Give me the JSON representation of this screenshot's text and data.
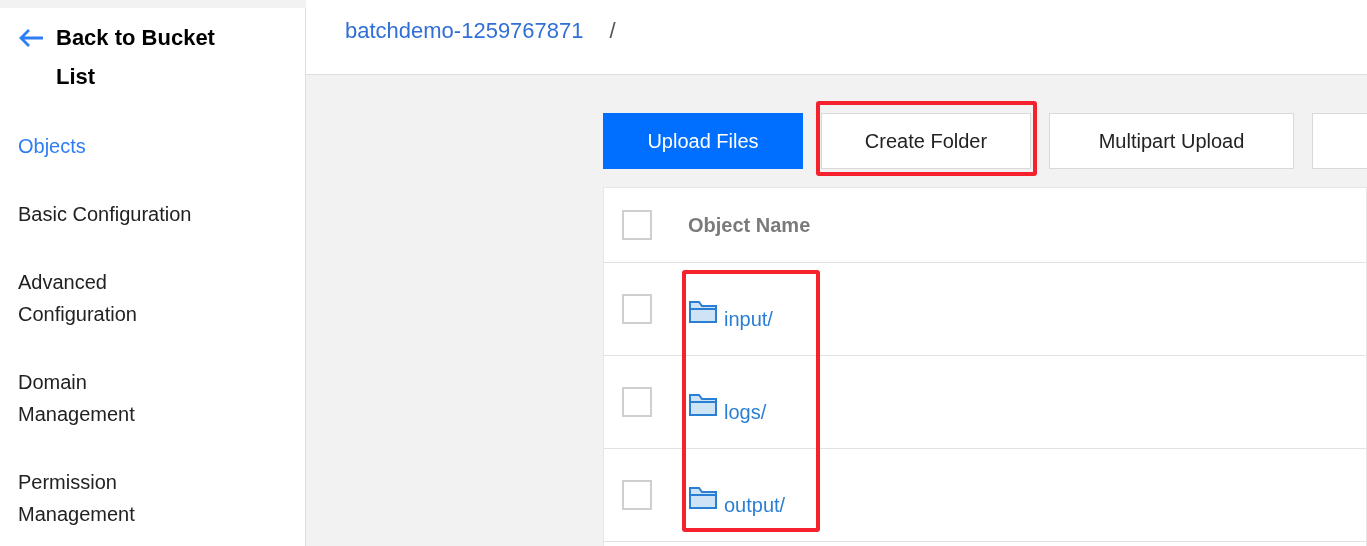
{
  "sidebar": {
    "back_link": "Back to Bucket List",
    "items": [
      {
        "label": "Objects",
        "selected": true
      },
      {
        "label": "Basic Configuration",
        "selected": false
      },
      {
        "label": "Advanced Configuration",
        "selected": false
      },
      {
        "label": "Domain Management",
        "selected": false
      },
      {
        "label": "Permission Management",
        "selected": false
      }
    ]
  },
  "breadcrumb": {
    "bucket": "batchdemo-1259767871",
    "separator": "/"
  },
  "toolbar": {
    "buttons": [
      {
        "label": "Upload Files",
        "kind": "primary",
        "highlighted": false
      },
      {
        "label": "Create Folder",
        "kind": "default",
        "highlighted": true
      },
      {
        "label": "Multipart Upload",
        "kind": "default",
        "highlighted": false
      },
      {
        "kind": "cut"
      }
    ]
  },
  "table": {
    "select_all_checked": false,
    "columns": [
      "Object Name"
    ],
    "name_column_highlighted": true,
    "rows": [
      {
        "name": "input/",
        "checked": false
      },
      {
        "name": "logs/",
        "checked": false
      },
      {
        "name": "output/",
        "checked": false
      }
    ]
  }
}
